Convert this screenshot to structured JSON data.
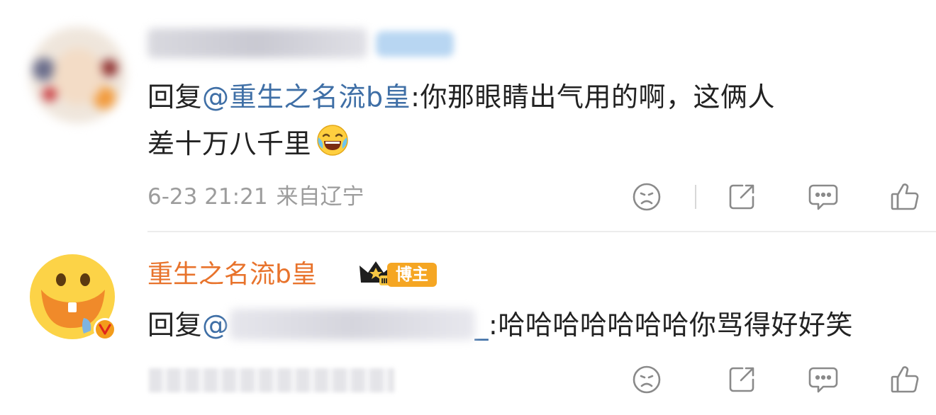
{
  "comments": [
    {
      "username": "",
      "reply_prefix": "回复",
      "mention": "@重生之名流b皇",
      "text_line1": ":你那眼睛出气用的啊，这俩人",
      "text_line2": "差十万八千里",
      "emoji": "laughing-tears-emoji",
      "time": "6-23 21:21",
      "location": "来自辽宁",
      "actions": [
        "dislike-icon",
        "share-icon",
        "comment-icon",
        "like-icon"
      ]
    },
    {
      "username": "重生之名流b皇",
      "badge": "博主",
      "crown_level": "Ⅲ",
      "reply_prefix": "回复",
      "mention_prefix": "@",
      "mention_suffix": "_",
      "text": ":哈哈哈哈哈哈哈你骂得好好笑",
      "actions": [
        "dislike-icon",
        "share-icon",
        "comment-icon",
        "like-icon"
      ]
    }
  ],
  "colors": {
    "mention": "#3f6fa6",
    "blogger_name": "#e8732c",
    "badge": "#f5a623",
    "meta_text": "#9c9c9c",
    "icon": "#8a8a8a"
  }
}
